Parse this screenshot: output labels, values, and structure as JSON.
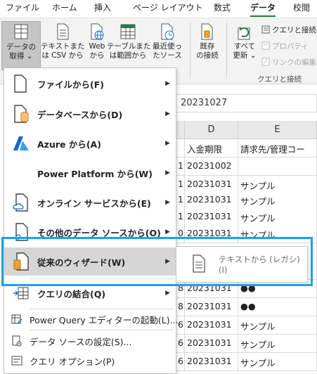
{
  "ribbon_tabs": [
    "ファイル",
    "ホーム",
    "挿入",
    "ページ レイアウト",
    "数式",
    "データ",
    "校閲"
  ],
  "active_tab": "データ",
  "ribbon": {
    "get_data": "データの\n取得 ⌄",
    "from_text_csv": "テキストまた\nは CSV から",
    "from_web": "Web\nから",
    "from_table": "テーブルまた\nは範囲から",
    "recent_sources": "最近使っ\nたソース",
    "existing_connections": "既存\nの接続",
    "refresh_all": "すべて\n更新 ⌄",
    "queries_connections": "クエリと接続",
    "properties": "プロパティ",
    "edit_links": "リンクの編集",
    "group_label": "クエリと接続"
  },
  "formula_bar_value": "20231027",
  "columns": [
    "D",
    "E"
  ],
  "header_row": {
    "d": "入金期限",
    "e": "請求先/管理コー"
  },
  "rows": [
    {
      "c": "1",
      "d": "20231002",
      "e": ""
    },
    {
      "c": "1",
      "d": "20231031",
      "e": "サンプル"
    },
    {
      "c": "1",
      "d": "20231031",
      "e": "サンプル"
    },
    {
      "c": "1",
      "d": "20231031",
      "e": "サンプル"
    },
    {
      "c": "0",
      "d": "20231031",
      "e": "サンプル"
    },
    {
      "c": "",
      "d": "",
      "e": ""
    },
    {
      "c": "8",
      "d": "20231031",
      "e": "●●"
    },
    {
      "c": "8",
      "d": "20231031",
      "e": "●●"
    },
    {
      "c": "6",
      "d": "20231031",
      "e": "サンプル"
    },
    {
      "c": "6",
      "d": "20231031",
      "e": "サンプル"
    },
    {
      "c": "6",
      "d": "20231031",
      "e": "サンプル"
    }
  ],
  "menu": {
    "from_file": "ファイルから(F)",
    "from_database": "データベースから(D)",
    "from_azure": "Azure から(A)",
    "from_power_platform": "Power Platform から(W)",
    "from_online_services": "オンライン サービスから(E)",
    "from_other_sources": "その他のデータ ソースから(O)",
    "legacy_wizards": "従来のウィザード(W)",
    "combine_queries": "クエリの結合(Q)",
    "launch_power_query": "Power Query エディターの起動(L)...",
    "data_source_settings": "データ ソースの設定(S)...",
    "query_options": "クエリ オプション(P)"
  },
  "submenu": {
    "from_text_legacy": "テキストから (レガシ)(I)"
  },
  "colors": {
    "highlight_border": "#1aa3e0",
    "excel_green": "#217346"
  }
}
